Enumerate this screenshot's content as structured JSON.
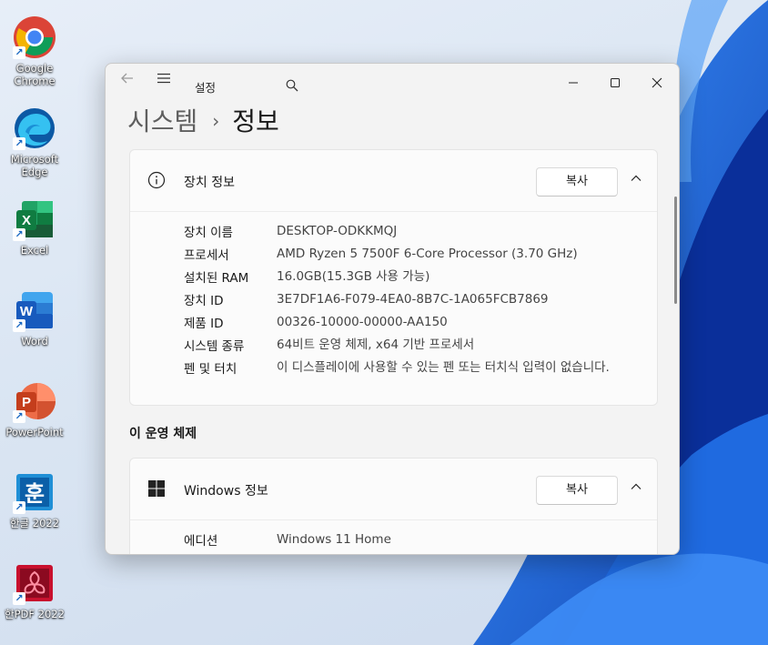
{
  "desktop": {
    "icons": [
      {
        "label": "Google Chrome",
        "icon": "chrome-icon"
      },
      {
        "label": "Microsoft Edge",
        "icon": "edge-icon"
      },
      {
        "label": "Excel",
        "icon": "excel-icon"
      },
      {
        "label": "Word",
        "icon": "word-icon"
      },
      {
        "label": "PowerPoint",
        "icon": "powerpoint-icon"
      },
      {
        "label": "한글 2022",
        "icon": "hangul-icon"
      },
      {
        "label": "한PDF 2022",
        "icon": "hanpdf-icon"
      }
    ]
  },
  "window": {
    "title": "설정",
    "breadcrumb": {
      "parent": "시스템",
      "separator": "›",
      "current": "정보"
    }
  },
  "device_card": {
    "title": "장치 정보",
    "copy_label": "복사",
    "specs": [
      {
        "key": "장치 이름",
        "value": "DESKTOP-ODKKMQJ"
      },
      {
        "key": "프로세서",
        "value": "AMD Ryzen 5 7500F 6-Core Processor (3.70 GHz)"
      },
      {
        "key": "설치된 RAM",
        "value": "16.0GB(15.3GB 사용 가능)"
      },
      {
        "key": "장치 ID",
        "value": "3E7DF1A6-F079-4EA0-8B7C-1A065FCB7869"
      },
      {
        "key": "제품 ID",
        "value": "00326-10000-00000-AA150"
      },
      {
        "key": "시스템 종류",
        "value": "64비트 운영 체제, x64 기반 프로세서"
      },
      {
        "key": "펜 및 터치",
        "value": "이 디스플레이에 사용할 수 있는 펜 또는 터치식 입력이 없습니다."
      }
    ]
  },
  "os_section": {
    "title": "이 운영 체제"
  },
  "windows_card": {
    "title": "Windows 정보",
    "copy_label": "복사",
    "specs": [
      {
        "key": "에디션",
        "value": "Windows 11 Home"
      }
    ]
  },
  "colors": {
    "accent": "#0067c0",
    "window_bg": "#f3f3f3",
    "card_bg": "#fbfbfb"
  }
}
